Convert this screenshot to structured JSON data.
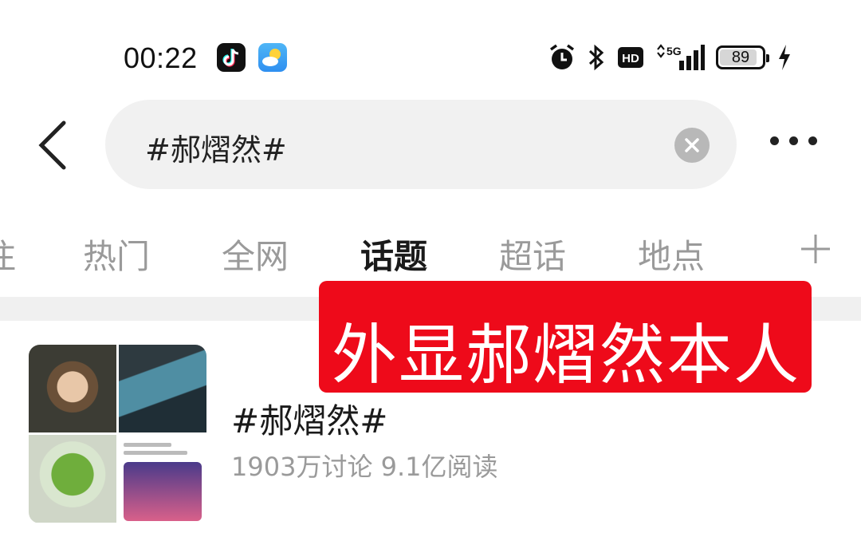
{
  "status_bar": {
    "time": "00:22",
    "app_icons": [
      "tiktok-icon",
      "weather-icon"
    ],
    "system_icons": [
      "alarm-icon",
      "bluetooth-icon",
      "hd-icon",
      "5g-signal-icon"
    ],
    "hd_label": "HD",
    "network_label": "5G",
    "battery_level": "89",
    "battery_fraction": 0.89,
    "charging": true
  },
  "search": {
    "query": "#郝熠然#",
    "back_icon": "chevron-left-icon",
    "clear_icon": "close-icon",
    "more_icon": "more-horizontal-icon"
  },
  "tabs": [
    {
      "label": "注",
      "active": false
    },
    {
      "label": "热门",
      "active": false
    },
    {
      "label": "全网",
      "active": false
    },
    {
      "label": "话题",
      "active": true
    },
    {
      "label": "超话",
      "active": false
    },
    {
      "label": "地点",
      "active": false
    }
  ],
  "add_tab_icon": "plus-icon",
  "banner": {
    "text": "外显郝熠然本人",
    "color": "#ee0a1a"
  },
  "result": {
    "title": "#郝熠然#",
    "meta": "1903万讨论 9.1亿阅读"
  },
  "colors": {
    "accent_text": "#1a1a1a",
    "muted_text": "#9a9a9a",
    "search_bg": "#f1f1f1"
  }
}
